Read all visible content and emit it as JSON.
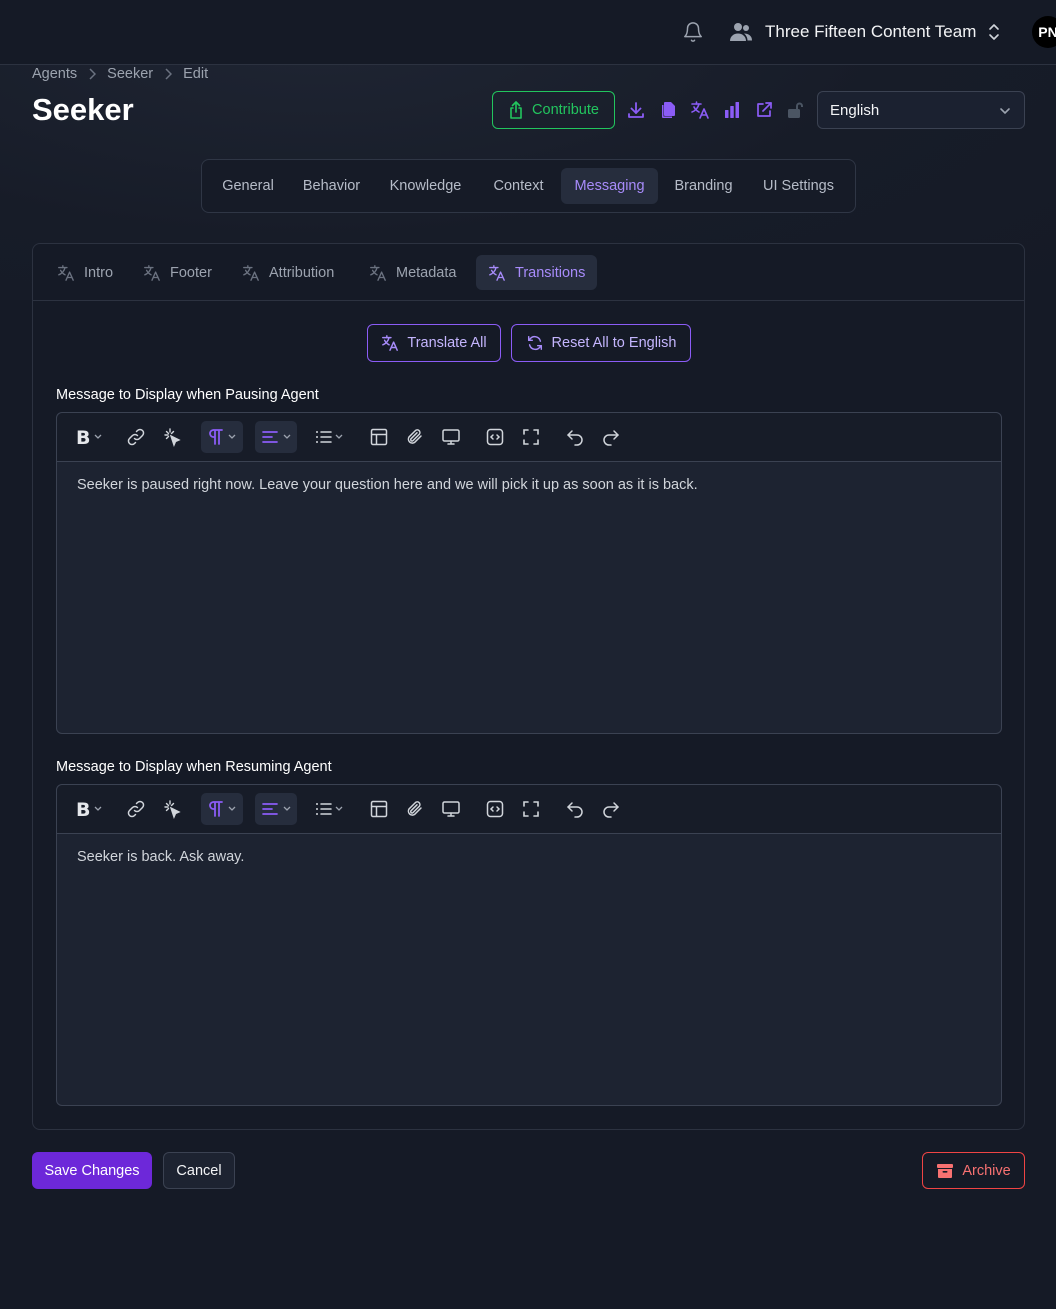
{
  "header": {
    "team_name": "Three Fifteen Content Team",
    "avatar_initials": "PN"
  },
  "breadcrumb": [
    "Agents",
    "Seeker",
    "Edit"
  ],
  "page_title": "Seeker",
  "toolbar": {
    "contribute_label": "Contribute",
    "icons": [
      "download-icon",
      "copy-icon",
      "translate-icon",
      "analytics-icon",
      "external-link-icon",
      "unlock-icon"
    ],
    "language_value": "English"
  },
  "main_tabs": [
    {
      "label": "General",
      "active": false
    },
    {
      "label": "Behavior",
      "active": false
    },
    {
      "label": "Knowledge",
      "active": false
    },
    {
      "label": "Context",
      "active": false
    },
    {
      "label": "Messaging",
      "active": true
    },
    {
      "label": "Branding",
      "active": false
    },
    {
      "label": "UI Settings",
      "active": false
    }
  ],
  "sub_tabs": [
    {
      "label": "Intro",
      "active": false
    },
    {
      "label": "Footer",
      "active": false
    },
    {
      "label": "Attribution",
      "active": false
    },
    {
      "label": "Metadata",
      "active": false
    },
    {
      "label": "Transitions",
      "active": true
    }
  ],
  "actions": {
    "translate_all": "Translate All",
    "reset_all": "Reset All to English"
  },
  "fields": [
    {
      "label": "Message to Display when Pausing Agent",
      "value": "Seeker is paused right now. Leave your question here and we will pick it up as soon as it is back."
    },
    {
      "label": "Message to Display when Resuming Agent",
      "value": "Seeker is back. Ask away."
    }
  ],
  "footer": {
    "save_label": "Save Changes",
    "cancel_label": "Cancel",
    "archive_label": "Archive"
  },
  "colors": {
    "accent": "#a78bfa",
    "primary_button": "#6d28d9",
    "success": "#22c55e",
    "danger": "#ef4444",
    "background": "#151a26"
  }
}
